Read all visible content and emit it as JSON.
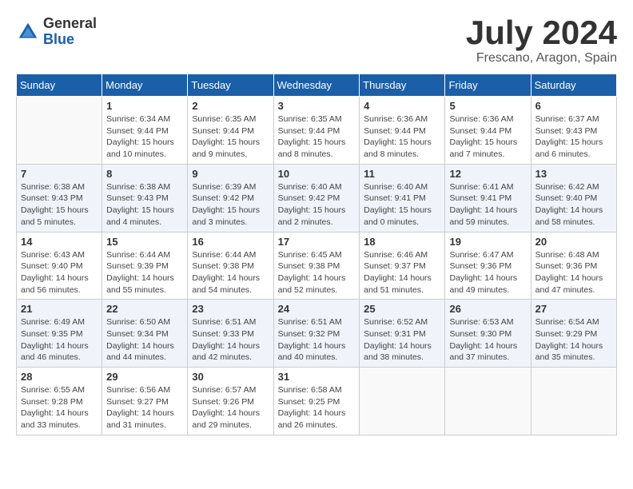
{
  "logo": {
    "general": "General",
    "blue": "Blue"
  },
  "header": {
    "month_year": "July 2024",
    "location": "Frescano, Aragon, Spain"
  },
  "days_of_week": [
    "Sunday",
    "Monday",
    "Tuesday",
    "Wednesday",
    "Thursday",
    "Friday",
    "Saturday"
  ],
  "weeks": [
    [
      {
        "day": "",
        "info": ""
      },
      {
        "day": "1",
        "info": "Sunrise: 6:34 AM\nSunset: 9:44 PM\nDaylight: 15 hours\nand 10 minutes."
      },
      {
        "day": "2",
        "info": "Sunrise: 6:35 AM\nSunset: 9:44 PM\nDaylight: 15 hours\nand 9 minutes."
      },
      {
        "day": "3",
        "info": "Sunrise: 6:35 AM\nSunset: 9:44 PM\nDaylight: 15 hours\nand 8 minutes."
      },
      {
        "day": "4",
        "info": "Sunrise: 6:36 AM\nSunset: 9:44 PM\nDaylight: 15 hours\nand 8 minutes."
      },
      {
        "day": "5",
        "info": "Sunrise: 6:36 AM\nSunset: 9:44 PM\nDaylight: 15 hours\nand 7 minutes."
      },
      {
        "day": "6",
        "info": "Sunrise: 6:37 AM\nSunset: 9:43 PM\nDaylight: 15 hours\nand 6 minutes."
      }
    ],
    [
      {
        "day": "7",
        "info": "Sunrise: 6:38 AM\nSunset: 9:43 PM\nDaylight: 15 hours\nand 5 minutes."
      },
      {
        "day": "8",
        "info": "Sunrise: 6:38 AM\nSunset: 9:43 PM\nDaylight: 15 hours\nand 4 minutes."
      },
      {
        "day": "9",
        "info": "Sunrise: 6:39 AM\nSunset: 9:42 PM\nDaylight: 15 hours\nand 3 minutes."
      },
      {
        "day": "10",
        "info": "Sunrise: 6:40 AM\nSunset: 9:42 PM\nDaylight: 15 hours\nand 2 minutes."
      },
      {
        "day": "11",
        "info": "Sunrise: 6:40 AM\nSunset: 9:41 PM\nDaylight: 15 hours\nand 0 minutes."
      },
      {
        "day": "12",
        "info": "Sunrise: 6:41 AM\nSunset: 9:41 PM\nDaylight: 14 hours\nand 59 minutes."
      },
      {
        "day": "13",
        "info": "Sunrise: 6:42 AM\nSunset: 9:40 PM\nDaylight: 14 hours\nand 58 minutes."
      }
    ],
    [
      {
        "day": "14",
        "info": "Sunrise: 6:43 AM\nSunset: 9:40 PM\nDaylight: 14 hours\nand 56 minutes."
      },
      {
        "day": "15",
        "info": "Sunrise: 6:44 AM\nSunset: 9:39 PM\nDaylight: 14 hours\nand 55 minutes."
      },
      {
        "day": "16",
        "info": "Sunrise: 6:44 AM\nSunset: 9:38 PM\nDaylight: 14 hours\nand 54 minutes."
      },
      {
        "day": "17",
        "info": "Sunrise: 6:45 AM\nSunset: 9:38 PM\nDaylight: 14 hours\nand 52 minutes."
      },
      {
        "day": "18",
        "info": "Sunrise: 6:46 AM\nSunset: 9:37 PM\nDaylight: 14 hours\nand 51 minutes."
      },
      {
        "day": "19",
        "info": "Sunrise: 6:47 AM\nSunset: 9:36 PM\nDaylight: 14 hours\nand 49 minutes."
      },
      {
        "day": "20",
        "info": "Sunrise: 6:48 AM\nSunset: 9:36 PM\nDaylight: 14 hours\nand 47 minutes."
      }
    ],
    [
      {
        "day": "21",
        "info": "Sunrise: 6:49 AM\nSunset: 9:35 PM\nDaylight: 14 hours\nand 46 minutes."
      },
      {
        "day": "22",
        "info": "Sunrise: 6:50 AM\nSunset: 9:34 PM\nDaylight: 14 hours\nand 44 minutes."
      },
      {
        "day": "23",
        "info": "Sunrise: 6:51 AM\nSunset: 9:33 PM\nDaylight: 14 hours\nand 42 minutes."
      },
      {
        "day": "24",
        "info": "Sunrise: 6:51 AM\nSunset: 9:32 PM\nDaylight: 14 hours\nand 40 minutes."
      },
      {
        "day": "25",
        "info": "Sunrise: 6:52 AM\nSunset: 9:31 PM\nDaylight: 14 hours\nand 38 minutes."
      },
      {
        "day": "26",
        "info": "Sunrise: 6:53 AM\nSunset: 9:30 PM\nDaylight: 14 hours\nand 37 minutes."
      },
      {
        "day": "27",
        "info": "Sunrise: 6:54 AM\nSunset: 9:29 PM\nDaylight: 14 hours\nand 35 minutes."
      }
    ],
    [
      {
        "day": "28",
        "info": "Sunrise: 6:55 AM\nSunset: 9:28 PM\nDaylight: 14 hours\nand 33 minutes."
      },
      {
        "day": "29",
        "info": "Sunrise: 6:56 AM\nSunset: 9:27 PM\nDaylight: 14 hours\nand 31 minutes."
      },
      {
        "day": "30",
        "info": "Sunrise: 6:57 AM\nSunset: 9:26 PM\nDaylight: 14 hours\nand 29 minutes."
      },
      {
        "day": "31",
        "info": "Sunrise: 6:58 AM\nSunset: 9:25 PM\nDaylight: 14 hours\nand 26 minutes."
      },
      {
        "day": "",
        "info": ""
      },
      {
        "day": "",
        "info": ""
      },
      {
        "day": "",
        "info": ""
      }
    ]
  ]
}
